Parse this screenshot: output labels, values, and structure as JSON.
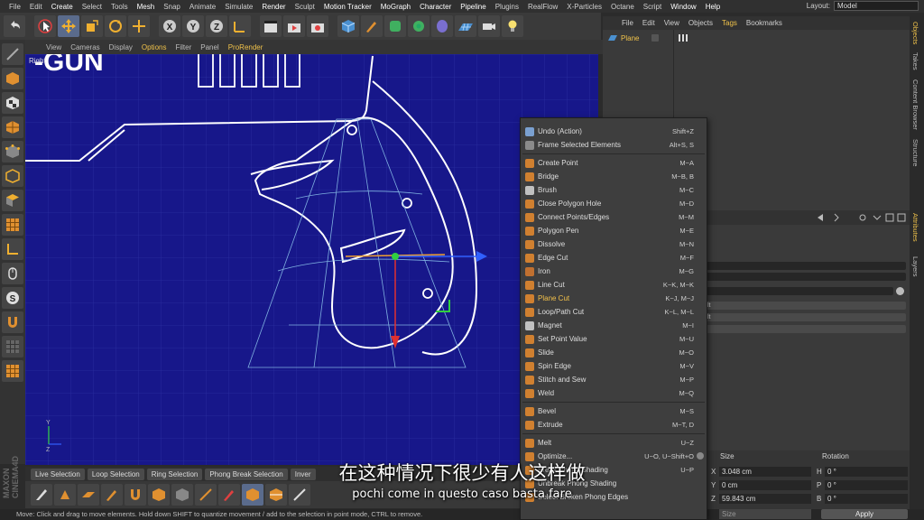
{
  "menubar": {
    "items": [
      "File",
      "Edit",
      "Create",
      "Select",
      "Tools",
      "Mesh",
      "Snap",
      "Animate",
      "Simulate",
      "Render",
      "Sculpt",
      "Motion Tracker",
      "MoGraph",
      "Character",
      "Pipeline",
      "Plugins",
      "RealFlow",
      "X-Particles",
      "Octane",
      "Script",
      "Window",
      "Help"
    ],
    "layout_label": "Layout:",
    "layout_value": "Model"
  },
  "viewport": {
    "menu": [
      "View",
      "Cameras",
      "Display",
      "Options",
      "Filter",
      "Panel",
      "ProRender"
    ],
    "label": "Right",
    "logo_text": "-GUN"
  },
  "bottom_tabs": [
    "Live Selection",
    "Loop Selection",
    "Ring Selection",
    "Phong Break Selection",
    "Inver"
  ],
  "status_text": "Move: Click and drag to move elements. Hold down SHIFT to quantize movement / add to the selection in point mode, CTRL to remove.",
  "object_manager": {
    "menu": [
      "File",
      "Edit",
      "View",
      "Objects",
      "Tags",
      "Bookmarks"
    ],
    "object_name": "Plane"
  },
  "right_tabs": [
    "Objects",
    "Takes",
    "Content Browser",
    "Structure",
    "Attributes",
    "Layers"
  ],
  "attributes": {
    "drop1": "lt",
    "drop2": "lt"
  },
  "coordinates": {
    "size_header": "Size",
    "rotation_header": "Rotation",
    "rows": [
      {
        "label": "X",
        "size": "3.048 cm",
        "rlabel": "H",
        "rot": "0 °"
      },
      {
        "label": "Y",
        "size": "0 cm",
        "rlabel": "P",
        "rot": "0 °"
      },
      {
        "label": "Z",
        "size": "59.843 cm",
        "rlabel": "B",
        "rot": "0 °"
      }
    ],
    "size_dropdown": "Size",
    "apply": "Apply"
  },
  "context_menu": {
    "items": [
      {
        "label": "Undo (Action)",
        "shortcut": "Shift+Z",
        "color": "#7aa0d0"
      },
      {
        "label": "Frame Selected Elements",
        "shortcut": "Alt+S, S",
        "color": "#8a8a8a"
      },
      {
        "label": "Create Point",
        "shortcut": "M~A",
        "color": "#d08030"
      },
      {
        "label": "Bridge",
        "shortcut": "M~B, B",
        "color": "#d08030"
      },
      {
        "label": "Brush",
        "shortcut": "M~C",
        "color": "#c0c0c0"
      },
      {
        "label": "Close Polygon Hole",
        "shortcut": "M~D",
        "color": "#d08030"
      },
      {
        "label": "Connect Points/Edges",
        "shortcut": "M~M",
        "color": "#d08030"
      },
      {
        "label": "Polygon Pen",
        "shortcut": "M~E",
        "color": "#d08030"
      },
      {
        "label": "Dissolve",
        "shortcut": "M~N",
        "color": "#d08030"
      },
      {
        "label": "Edge Cut",
        "shortcut": "M~F",
        "color": "#d08030"
      },
      {
        "label": "Iron",
        "shortcut": "M~G",
        "color": "#c07030"
      },
      {
        "label": "Line Cut",
        "shortcut": "K~K, M~K",
        "color": "#d08030"
      },
      {
        "label": "Plane Cut",
        "shortcut": "K~J, M~J",
        "color": "#d08030"
      },
      {
        "label": "Loop/Path Cut",
        "shortcut": "K~L, M~L",
        "color": "#d08030"
      },
      {
        "label": "Magnet",
        "shortcut": "M~I",
        "color": "#c0c0c0"
      },
      {
        "label": "Set Point Value",
        "shortcut": "M~U",
        "color": "#d08030"
      },
      {
        "label": "Slide",
        "shortcut": "M~O",
        "color": "#d08030"
      },
      {
        "label": "Spin Edge",
        "shortcut": "M~V",
        "color": "#d08030"
      },
      {
        "label": "Stitch and Sew",
        "shortcut": "M~P",
        "color": "#d08030"
      },
      {
        "label": "Weld",
        "shortcut": "M~Q",
        "color": "#d08030"
      },
      {
        "label": "Bevel",
        "shortcut": "M~S",
        "color": "#d08030"
      },
      {
        "label": "Extrude",
        "shortcut": "M~T, D",
        "color": "#d08030"
      },
      {
        "label": "Melt",
        "shortcut": "U~Z",
        "color": "#d08030"
      },
      {
        "label": "Optimize...",
        "shortcut": "U~O, U~Shift+O",
        "color": "#d08030"
      },
      {
        "label": "Break Phong Shading",
        "shortcut": "U~P",
        "color": "#d08030"
      },
      {
        "label": "Unbreak Phong Shading",
        "shortcut": "",
        "color": "#d08030"
      },
      {
        "label": "Select Broken Phong Edges",
        "shortcut": "",
        "color": "#d08030"
      }
    ]
  },
  "subtitles": {
    "zh": "在这种情况下很少有人这样做",
    "it": "pochi come in questo caso basta fare"
  }
}
